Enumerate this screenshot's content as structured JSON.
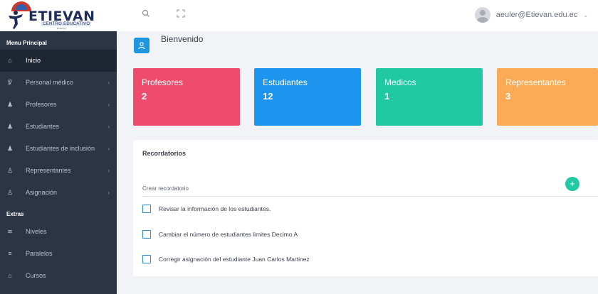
{
  "brand": {
    "name": "ETIEVAN",
    "subtitle": "CENTRO EDUCATIVO",
    "tagline": "ETIEVAN"
  },
  "topbar": {
    "search_icon": "search-icon",
    "fullscreen_icon": "fullscreen-icon",
    "user_email": "aeuler@Etievan.edu.ec",
    "caret": "⌄"
  },
  "sidebar": {
    "section_main": "Menu Principal",
    "section_extras": "Extras",
    "items": [
      {
        "label": "Inicio",
        "icon": "home-icon",
        "glyph": "⌂",
        "has_children": false,
        "active": true
      },
      {
        "label": "Personal médico",
        "icon": "stethoscope-icon",
        "glyph": "℣",
        "has_children": true
      },
      {
        "label": "Profesores",
        "icon": "teacher-icon",
        "glyph": "♟",
        "has_children": true
      },
      {
        "label": "Estudiantes",
        "icon": "student-icon",
        "glyph": "♟",
        "has_children": true
      },
      {
        "label": "Estudiantes de inclusión",
        "icon": "inclusion-student-icon",
        "glyph": "♟",
        "has_children": true
      },
      {
        "label": "Representantes",
        "icon": "user-icon",
        "glyph": "♙",
        "has_children": true
      },
      {
        "label": "Asignación",
        "icon": "users-icon",
        "glyph": "♙",
        "has_children": true
      }
    ],
    "extras": [
      {
        "label": "Niveles",
        "icon": "layers-icon",
        "glyph": "≋"
      },
      {
        "label": "Paralelos",
        "icon": "menu-icon",
        "glyph": "≡"
      },
      {
        "label": "Cursos",
        "icon": "building-icon",
        "glyph": "⌂"
      }
    ],
    "chevron": "›"
  },
  "main": {
    "welcome": "Bienvenido",
    "stats": [
      {
        "name": "Profesores",
        "value": "2",
        "color": "#ef4b6b"
      },
      {
        "name": "Estudiantes",
        "value": "12",
        "color": "#1d95ee"
      },
      {
        "name": "Medicos",
        "value": "1",
        "color": "#20c9a4"
      },
      {
        "name": "Representantes",
        "value": "3",
        "color": "#fbaa55"
      }
    ],
    "reminders": {
      "title": "Recordatorios",
      "create_label": "Crear recordatorio",
      "add_button": "+",
      "items": [
        "Revisar la información de los estudiantes.",
        "Cambiar el número de estudiantes limites Decimo A",
        "Corregir asignación del estudiante Juan Carlos Martinez"
      ]
    }
  }
}
